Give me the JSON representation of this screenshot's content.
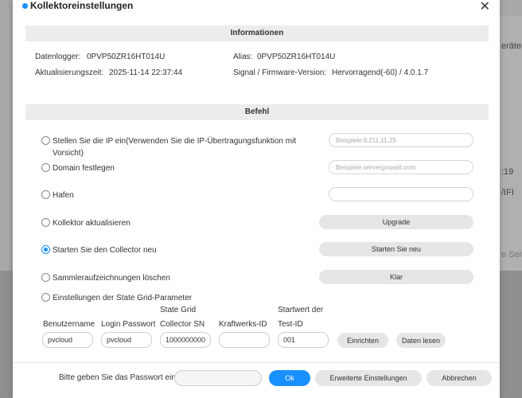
{
  "background": {
    "right_fragments": [
      "erätem",
      ":19",
      "/IFI",
      "e Seite"
    ]
  },
  "modal": {
    "title": "Kollektoreinstellungen",
    "close_symbol": "✕"
  },
  "info": {
    "header": "Informationen",
    "datalogger_label": "Datenlogger:",
    "datalogger_value": "0PVP50ZR16HT014U",
    "alias_label": "Alias:",
    "alias_value": "0PVP50ZR16HT014U",
    "update_label": "Aktualisierungszeit:",
    "update_value": "2025-11-14 22:37:44",
    "signal_label": "Signal / Firmware-Version:",
    "signal_value": "Hervorragend(-60) / 4.0.1.7"
  },
  "command": {
    "header": "Befehl",
    "options": [
      {
        "label": "Stellen Sie die IP ein(Verwenden Sie die IP-Übertragungsfunktion mit Vorsicht)",
        "checked": false
      },
      {
        "label": "Domain festlegen",
        "checked": false
      },
      {
        "label": "Hafen",
        "checked": false
      },
      {
        "label": "Kollektor aktualisieren",
        "checked": false
      },
      {
        "label": "Starten Sie den Collector neu",
        "checked": true
      },
      {
        "label": "Sammleraufzeichnungen löschen",
        "checked": false
      },
      {
        "label": "Einstellungen der State Grid-Parameter",
        "checked": false
      }
    ],
    "ip_placeholder": "Beispiele:8.211.11.25",
    "domain_placeholder": "Beispiele:servergrowatt.com",
    "port_value": "",
    "upgrade_button": "Upgrade",
    "restart_button": "Starten Sie neu",
    "clear_button": "Klar"
  },
  "grid": {
    "username_label": "Benutzername",
    "username_value": "pvcloud",
    "password_label": "Login Passwort",
    "password_value": "pvcloud",
    "sn_label_line1": "State Grid",
    "sn_label_line2": "Collector SN",
    "sn_value": "1000000000",
    "plant_label": "Kraftwerks-ID",
    "plant_value": "",
    "test_label_line1": "Startwert der",
    "test_label_line2": "Test-ID",
    "test_value": "001",
    "setup_button": "Einrichten",
    "read_button": "Daten lesen"
  },
  "footer": {
    "password_prompt": "Bitte geben Sie das Passwort ein",
    "password_value": "",
    "ok_button": "Ok",
    "advanced_button": "Erweiterte Einstellungen",
    "cancel_button": "Abbrechen"
  }
}
